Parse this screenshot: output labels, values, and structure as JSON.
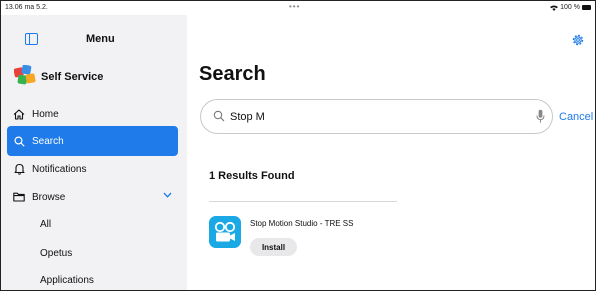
{
  "status_bar": {
    "time": "13.06  ma 5.2.",
    "dots": "•••",
    "battery": "100 %"
  },
  "sidebar": {
    "title": "Menu",
    "app_name": "Self Service",
    "items": [
      {
        "label": "Home",
        "icon": "home-icon"
      },
      {
        "label": "Search",
        "icon": "search-icon",
        "active": true
      },
      {
        "label": "Notifications",
        "icon": "bell-icon"
      },
      {
        "label": "Browse",
        "icon": "folder-icon",
        "expanded": true
      }
    ],
    "browse_subitems": [
      "All",
      "Opetus",
      "Applications"
    ]
  },
  "main": {
    "title": "Search",
    "search": {
      "value": "Stop M",
      "cancel_label": "Cancel"
    },
    "results_count_label": "1 Results Found",
    "results": [
      {
        "name": "Stop Motion Studio - TRE SS",
        "action_label": "Install"
      }
    ]
  },
  "colors": {
    "accent": "#1f7aea",
    "sidebar_bg": "#f2f2f4",
    "app_icon": "#1ba9e6"
  }
}
